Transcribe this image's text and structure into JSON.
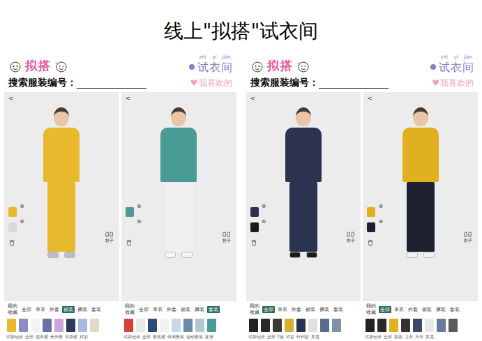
{
  "title": "线上\"拟搭\"试衣间",
  "apps": [
    {
      "logo": "拟搭",
      "name": [
        {
          "char": "试",
          "pinyin": "zhì"
        },
        {
          "char": "衣",
          "pinyin": "yī"
        },
        {
          "char": "间",
          "pinyin": "jiān"
        }
      ],
      "search_label": "搜索服装编号：",
      "favorites": {
        "icon": "♥",
        "label": "我喜欢的"
      },
      "screens": [
        {
          "back": "<",
          "top_color": "#e8b92c",
          "bottom_color": "#e8b92c",
          "shoe_color": "#b9bcc4",
          "side_items": [
            {
              "color": "#e8b92c",
              "remove": "⊗"
            },
            {
              "color": "#d8d8d8",
              "remove": "⊗"
            }
          ],
          "shoes_label": "鞋子",
          "tabs": [
            {
              "label": "我的收藏",
              "selected": false
            },
            {
              "label": "全部",
              "selected": false
            },
            {
              "label": "单衣",
              "selected": false
            },
            {
              "label": "外套",
              "selected": false
            },
            {
              "label": "裙装",
              "selected": true
            },
            {
              "label": "裤装",
              "selected": false
            },
            {
              "label": "套装",
              "selected": false
            }
          ],
          "thumbnails": [
            {
              "color": "#e8b92c"
            },
            {
              "color": "#8c8cc0"
            },
            {
              "color": "#f3f3f3"
            },
            {
              "color": "#6a6fa8"
            },
            {
              "color": "#c9a7d8"
            },
            {
              "color": "#2d3a5e"
            },
            {
              "color": "#a8b8e0"
            },
            {
              "color": "#e4d8c8"
            }
          ],
          "categories": [
            "试穿记录",
            "全部",
            "连衣裙",
            "长外套",
            "半身裙",
            "衬衫"
          ]
        },
        {
          "back": "<",
          "top_color": "#4a9a95",
          "bottom_color": "#f1eef0",
          "shoe_color": "#f5f5f5",
          "side_items": [
            {
              "color": "#4a9a95",
              "remove": "⊗"
            },
            {
              "color": "#eeeeee",
              "remove": "⊗"
            }
          ],
          "shoes_label": "鞋子",
          "tabs": [
            {
              "label": "我的收藏",
              "selected": false
            },
            {
              "label": "全部",
              "selected": false
            },
            {
              "label": "单衣",
              "selected": false
            },
            {
              "label": "外套",
              "selected": false
            },
            {
              "label": "裙装",
              "selected": false
            },
            {
              "label": "裤装",
              "selected": false
            },
            {
              "label": "套装",
              "selected": true
            }
          ],
          "thumbnails": [
            {
              "color": "#d8413a"
            },
            {
              "color": "#e8e8e8"
            },
            {
              "color": "#2e4a7a"
            },
            {
              "color": "#f2f2f2"
            },
            {
              "color": "#c8d8e8"
            },
            {
              "color": "#6a8aa8"
            },
            {
              "color": "#b0c8d0"
            },
            {
              "color": "#4a9a95"
            }
          ],
          "categories": [
            "试穿记录",
            "全部",
            "套装裙",
            "休闲套装",
            "运动套装",
            "家居"
          ]
        }
      ]
    },
    {
      "logo": "拟搭",
      "name": [
        {
          "char": "试",
          "pinyin": "zhì"
        },
        {
          "char": "衣",
          "pinyin": "yī"
        },
        {
          "char": "间",
          "pinyin": "jiān"
        }
      ],
      "search_label": "搜索服装编号：",
      "favorites": {
        "icon": "♥",
        "label": "我喜欢的"
      },
      "screens": [
        {
          "back": "<",
          "top_color": "#2c3350",
          "bottom_color": "#2c3350",
          "shoe_color": "#1a1a1a",
          "side_items": [
            {
              "color": "#2c3350",
              "remove": "⊗"
            },
            {
              "color": "#1a1a1a",
              "remove": "⊗"
            }
          ],
          "shoes_label": "鞋子",
          "tabs": [
            {
              "label": "我的收藏",
              "selected": false
            },
            {
              "label": "全部",
              "selected": true
            },
            {
              "label": "单衣",
              "selected": false
            },
            {
              "label": "外套",
              "selected": false
            },
            {
              "label": "裙装",
              "selected": false
            },
            {
              "label": "裤装",
              "selected": false
            },
            {
              "label": "套装",
              "selected": false
            }
          ],
          "thumbnails": [
            {
              "color": "#222222"
            },
            {
              "color": "#2a2a2a"
            },
            {
              "color": "#3a3a3a"
            },
            {
              "color": "#d8b030"
            },
            {
              "color": "#2c3350"
            },
            {
              "color": "#e0e0e0"
            },
            {
              "color": "#5a6a8a"
            },
            {
              "color": "#8090a8"
            }
          ],
          "categories": [
            "试穿记录",
            "全部",
            "T恤",
            "衬衫",
            "针织衫",
            "夹克"
          ]
        },
        {
          "back": "<",
          "top_color": "#e0b020",
          "bottom_color": "#1e2230",
          "shoe_color": "#f2f2f2",
          "side_items": [
            {
              "color": "#e0b020",
              "remove": "⊗"
            },
            {
              "color": "#1e2230",
              "remove": "⊗"
            }
          ],
          "shoes_label": "鞋子",
          "tabs": [
            {
              "label": "我的收藏",
              "selected": false
            },
            {
              "label": "全部",
              "selected": true
            },
            {
              "label": "单衣",
              "selected": false
            },
            {
              "label": "外套",
              "selected": false
            },
            {
              "label": "裙装",
              "selected": false
            },
            {
              "label": "裤装",
              "selected": false
            },
            {
              "label": "套装",
              "selected": false
            }
          ],
          "thumbnails": [
            {
              "color": "#222222"
            },
            {
              "color": "#2a2a2a"
            },
            {
              "color": "#e0b020"
            },
            {
              "color": "#333333"
            },
            {
              "color": "#3a4a6a"
            },
            {
              "color": "#e8e8e8"
            },
            {
              "color": "#6a7a9a"
            },
            {
              "color": "#5a5a5a"
            }
          ],
          "categories": [
            "试穿记录",
            "全部",
            "西装",
            "卫衣",
            "大衣",
            "夹克"
          ]
        }
      ]
    }
  ]
}
